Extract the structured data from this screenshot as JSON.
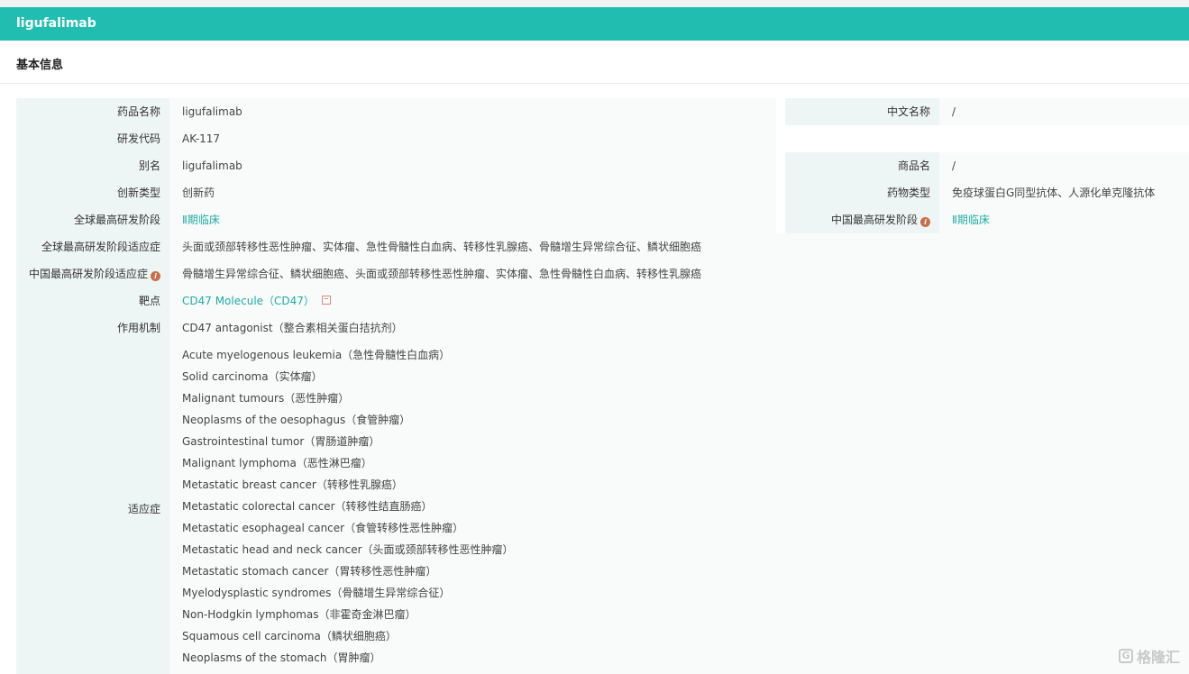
{
  "drug": {
    "title": "ligufalimab"
  },
  "section": {
    "title": "基本信息"
  },
  "rows": {
    "name": {
      "label": "药品名称",
      "value": "ligufalimab",
      "right_label": "中文名称",
      "right_value": "/"
    },
    "code": {
      "label": "研发代码",
      "value": "AK-117"
    },
    "alias": {
      "label": "别名",
      "value": "ligufalimab",
      "right_label": "商品名",
      "right_value": "/"
    },
    "innovation": {
      "label": "创新类型",
      "value": "创新药",
      "right_label": "药物类型",
      "right_value": "免疫球蛋白G同型抗体、人源化单克隆抗体"
    },
    "stage": {
      "label": "全球最高研发阶段",
      "value": "Ⅱ期临床",
      "right_label": "中国最高研发阶段",
      "right_value": "Ⅱ期临床"
    },
    "global_indication": {
      "label": "全球最高研发阶段适应症",
      "value": "头面或颈部转移性恶性肿瘤、实体瘤、急性骨髓性白血病、转移性乳腺癌、骨髓增生异常综合征、鳞状细胞癌"
    },
    "china_indication": {
      "label": "中国最高研发阶段适应症",
      "value": "骨髓增生异常综合征、鳞状细胞癌、头面或颈部转移性恶性肿瘤、实体瘤、急性骨髓性白血病、转移性乳腺癌"
    },
    "target": {
      "label": "靶点",
      "value": "CD47 Molecule（CD47）"
    },
    "mechanism": {
      "label": "作用机制",
      "value": "CD47 antagonist（整合素相关蛋白拮抗剂）"
    },
    "indications": {
      "label": "适应症",
      "items": [
        "Acute myelogenous leukemia（急性骨髓性白血病）",
        "Solid carcinoma（实体瘤）",
        "Malignant tumours（恶性肿瘤）",
        "Neoplasms of the oesophagus（食管肿瘤）",
        "Gastrointestinal tumor（胃肠道肿瘤）",
        "Malignant lymphoma（恶性淋巴瘤）",
        "Metastatic breast cancer（转移性乳腺癌）",
        "Metastatic colorectal cancer（转移性结直肠癌）",
        "Metastatic esophageal cancer（食管转移性恶性肿瘤）",
        "Metastatic head and neck cancer（头面或颈部转移性恶性肿瘤）",
        "Metastatic stomach cancer（胃转移性恶性肿瘤）",
        "Myelodysplastic syndromes（骨髓增生异常综合征）",
        "Non-Hodgkin lymphomas（非霍奇金淋巴瘤）",
        "Squamous cell carcinoma（鳞状细胞癌）",
        "Neoplasms of the stomach（胃肿瘤）"
      ]
    }
  },
  "watermark": {
    "text": "格隆汇"
  },
  "colors": {
    "header": "#20bdb0",
    "link": "#20aca1",
    "label_bg": "#eef5f5",
    "info": "#c7704a"
  }
}
